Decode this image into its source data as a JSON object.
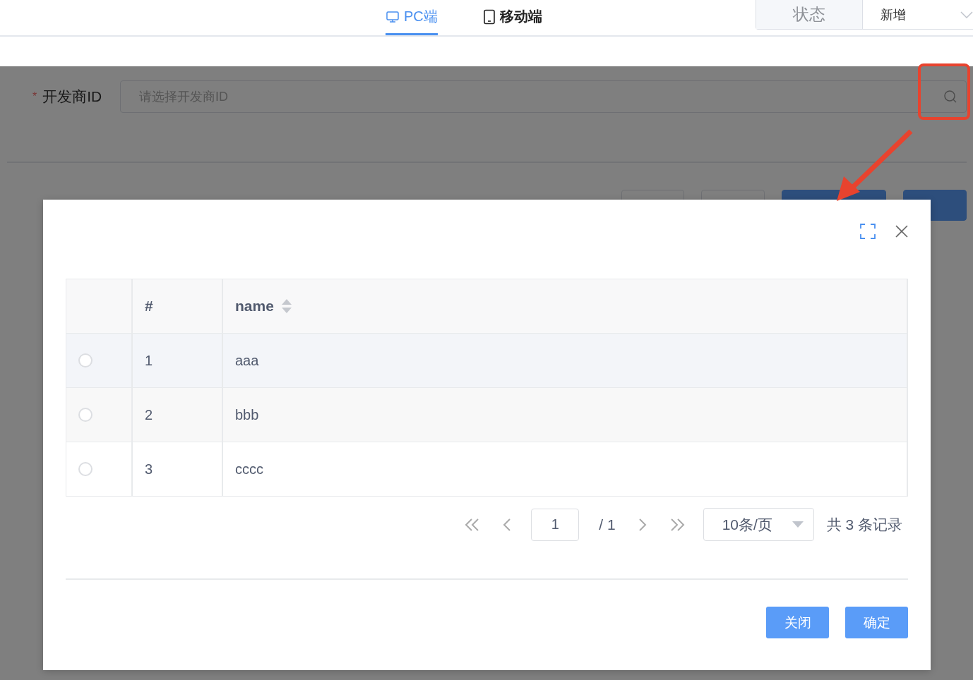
{
  "top_tabs": [
    {
      "label": "PC端",
      "kind": "monitor",
      "selected": true
    },
    {
      "label": "移动端",
      "kind": "tablet",
      "selected": false
    }
  ],
  "status_label": "状态",
  "status_select": {
    "value": "新增"
  },
  "form": {
    "required_mark": "*",
    "label": "开发商ID",
    "placeholder": "请选择开发商ID",
    "actions": [
      {
        "kind": "default"
      },
      {
        "kind": "default"
      },
      {
        "kind": "primary"
      },
      {
        "kind": "primary"
      }
    ]
  },
  "modal": {
    "table": {
      "columns": [
        "#",
        "name"
      ],
      "rows": [
        {
          "index": "1",
          "name": "aaa",
          "selected": false
        },
        {
          "index": "2",
          "name": "bbb",
          "selected": false
        },
        {
          "index": "3",
          "name": "cccc",
          "selected": false
        }
      ]
    },
    "pagination": {
      "page": "1",
      "total_pages": "/ 1",
      "page_size": "10条/页",
      "summary": "共 3 条记录"
    },
    "buttons": [
      "关闭",
      "确定"
    ]
  }
}
